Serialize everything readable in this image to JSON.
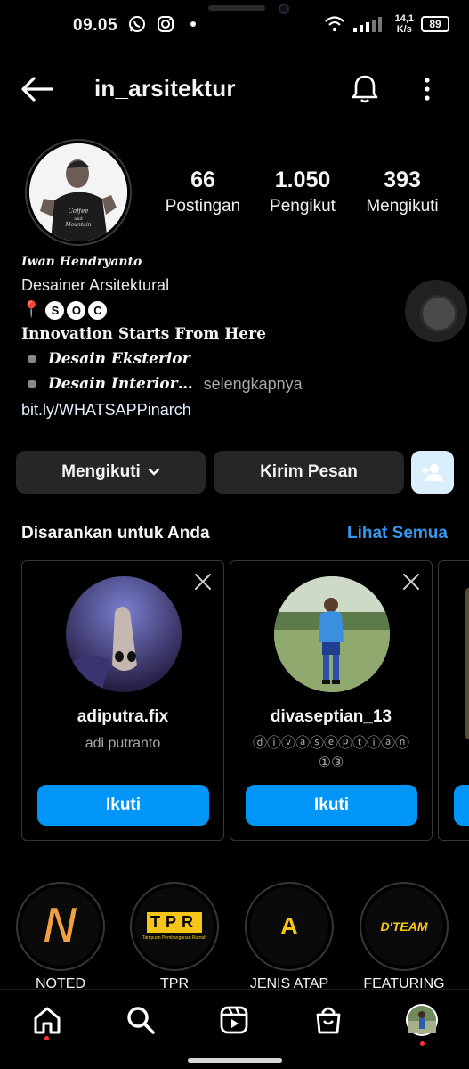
{
  "status_bar": {
    "time": "09.05",
    "net_speed_value": "14,1",
    "net_speed_unit": "K/s",
    "battery": "89"
  },
  "header": {
    "username": "in_arsitektur"
  },
  "profile": {
    "stats": [
      {
        "value": "66",
        "label": "Postingan"
      },
      {
        "value": "1.050",
        "label": "Pengikut"
      },
      {
        "value": "393",
        "label": "Mengikuti"
      }
    ],
    "bio": {
      "name": "Iwan Hendryanto",
      "title": "Desainer Arsitektural",
      "location_pin": "📍",
      "location_letters": [
        "S",
        "O",
        "C"
      ],
      "tagline": "Innovation Starts From Here",
      "item1": "Desain Eksterior",
      "item2": "Desain Interior…",
      "more": "selengkapnya",
      "link": "bit.ly/WHATSAPPinarch"
    }
  },
  "actions": {
    "following_label": "Mengikuti",
    "message_label": "Kirim Pesan"
  },
  "suggestions": {
    "title": "Disarankan untuk Anda",
    "see_all": "Lihat Semua",
    "cards": [
      {
        "username": "adiputra.fix",
        "subtitle": "adi putranto",
        "button": "Ikuti"
      },
      {
        "username": "divaseptian_13",
        "subtitle": "ⓓⓘⓥⓐⓢⓔⓟⓣⓘⓐⓝ ①③",
        "button": "Ikuti"
      }
    ]
  },
  "highlights": [
    {
      "label": "NOTED",
      "glyph": "N"
    },
    {
      "label": "TPR",
      "glyph": "TPR",
      "sub": "Tampuan Pembangunan Rumah"
    },
    {
      "label": "JENIS ATAP",
      "glyph": "A"
    },
    {
      "label": "FEATURING",
      "glyph": "D'TEAM"
    }
  ],
  "colors": {
    "accent_blue": "#0095f6",
    "link_blue": "#3797f0",
    "button_gray": "#262626",
    "background": "#000000",
    "highlight_orange": "#f0a040",
    "highlight_yellow": "#f5c518"
  },
  "icons": {
    "nav": [
      "home-icon",
      "search-icon",
      "reels-icon",
      "shop-icon",
      "profile-avatar"
    ]
  }
}
